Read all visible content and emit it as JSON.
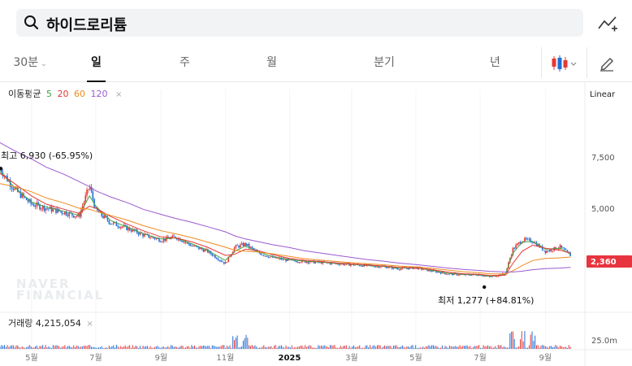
{
  "search": {
    "title": "하이드로리튬",
    "icon": "search-icon"
  },
  "compare_icon": "chart-compare-icon",
  "tabs": [
    {
      "label": "30분",
      "dropdown": true,
      "active": false
    },
    {
      "label": "일",
      "active": true
    },
    {
      "label": "주",
      "active": false
    },
    {
      "label": "월",
      "active": false
    },
    {
      "label": "분기",
      "active": false
    },
    {
      "label": "년",
      "active": false
    }
  ],
  "toolbar": {
    "chart_type_icon": "candlestick-icon",
    "draw_icon": "pencil-icon"
  },
  "ma_legend": {
    "title": "이동평균",
    "periods": [
      {
        "label": "5",
        "color": "#43a047"
      },
      {
        "label": "20",
        "color": "#e53935"
      },
      {
        "label": "60",
        "color": "#ef8a1c"
      },
      {
        "label": "120",
        "color": "#9b59d0"
      }
    ],
    "close": "×"
  },
  "scale_label": "Linear",
  "volume_legend": {
    "title": "거래량",
    "value": "4,215,054",
    "close": "×"
  },
  "watermark": [
    "NAVER",
    "FINANCIAL"
  ],
  "colors": {
    "up": "#e53935",
    "down": "#1e6fd9",
    "current_badge": "#e8343f"
  },
  "chart_data": {
    "type": "line",
    "price": {
      "x": [
        "2024-04-01",
        "2024-04-15",
        "2024-05-01",
        "2024-05-15",
        "2024-06-01",
        "2024-06-15",
        "2024-06-25",
        "2024-07-01",
        "2024-07-15",
        "2024-08-01",
        "2024-08-15",
        "2024-09-01",
        "2024-09-15",
        "2024-10-01",
        "2024-10-15",
        "2024-11-01",
        "2024-11-10",
        "2024-11-20",
        "2024-12-01",
        "2024-12-15",
        "2025-01-01",
        "2025-01-15",
        "2025-02-01",
        "2025-02-15",
        "2025-03-01",
        "2025-03-15",
        "2025-04-01",
        "2025-04-15",
        "2025-05-01",
        "2025-05-15",
        "2025-06-01",
        "2025-06-15",
        "2025-07-01",
        "2025-07-10",
        "2025-07-25",
        "2025-08-01",
        "2025-08-10",
        "2025-08-20",
        "2025-09-01",
        "2025-09-15",
        "2025-09-25"
      ],
      "close": [
        6930,
        5900,
        5200,
        5000,
        4800,
        4600,
        6100,
        4900,
        4300,
        4000,
        3700,
        3450,
        3600,
        3150,
        2900,
        2300,
        3100,
        3250,
        2850,
        2600,
        2450,
        2400,
        2350,
        2300,
        2250,
        2200,
        2150,
        2050,
        2100,
        1950,
        1800,
        1750,
        1760,
        1650,
        1800,
        3000,
        3450,
        3400,
        2900,
        3100,
        2700
      ]
    },
    "moving_averages": [
      {
        "period": "5",
        "values": [
          6800,
          6000,
          5300,
          5050,
          4850,
          4650,
          5600,
          5100,
          4400,
          4050,
          3750,
          3500,
          3550,
          3250,
          2950,
          2450,
          2900,
          3150,
          2900,
          2650,
          2480,
          2420,
          2360,
          2310,
          2260,
          2210,
          2160,
          2080,
          2090,
          1980,
          1820,
          1770,
          1750,
          1680,
          1760,
          2800,
          3350,
          3380,
          3000,
          3050,
          2750
        ]
      },
      {
        "period": "20",
        "values": [
          6700,
          6200,
          5600,
          5200,
          4950,
          4750,
          5100,
          5000,
          4600,
          4200,
          3900,
          3600,
          3550,
          3350,
          3100,
          2700,
          2750,
          3000,
          2950,
          2750,
          2550,
          2460,
          2390,
          2330,
          2280,
          2230,
          2180,
          2110,
          2090,
          2010,
          1880,
          1800,
          1770,
          1720,
          1730,
          2300,
          2900,
          3200,
          3050,
          2950,
          2800
        ]
      },
      {
        "period": "60",
        "values": [
          6200,
          6050,
          5800,
          5500,
          5250,
          5000,
          4950,
          4850,
          4650,
          4400,
          4150,
          3900,
          3750,
          3550,
          3350,
          3100,
          2950,
          2900,
          2870,
          2780,
          2650,
          2540,
          2460,
          2400,
          2340,
          2290,
          2240,
          2180,
          2140,
          2080,
          1980,
          1900,
          1850,
          1800,
          1790,
          1950,
          2200,
          2450,
          2550,
          2580,
          2620
        ]
      },
      {
        "period": "120",
        "values": [
          8200,
          7800,
          7400,
          7000,
          6650,
          6300,
          6050,
          5850,
          5550,
          5250,
          4950,
          4700,
          4500,
          4300,
          4100,
          3850,
          3650,
          3500,
          3380,
          3230,
          3080,
          2930,
          2800,
          2700,
          2600,
          2500,
          2410,
          2320,
          2250,
          2170,
          2080,
          2010,
          1960,
          1920,
          1890,
          1890,
          1930,
          2000,
          2050,
          2080,
          2110
        ]
      }
    ],
    "high_marker": {
      "label": "최고",
      "value": "6,930 (-65.95%)"
    },
    "low_marker": {
      "label": "최저",
      "value": "1,277 (+84.81%)"
    },
    "current_price": "2,360",
    "y_ticks": [
      "7,500",
      "5,000"
    ],
    "volume_tick": "25.0m",
    "x_ticks": [
      "5월",
      "7월",
      "9월",
      "11월",
      "2025",
      "3월",
      "5월",
      "7월",
      "9월"
    ]
  }
}
